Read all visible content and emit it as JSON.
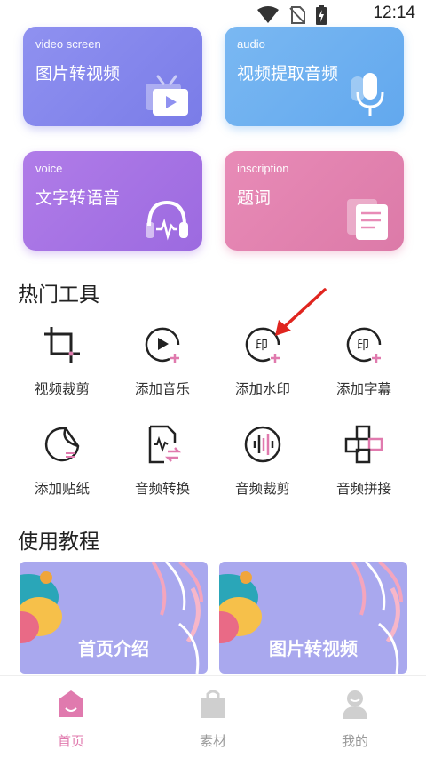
{
  "status_bar": {
    "time": "12:14"
  },
  "cards": [
    {
      "en": "video screen",
      "zh": "图片转视频",
      "icon": "tv-icon"
    },
    {
      "en": "audio",
      "zh": "视频提取音频",
      "icon": "microphone-icon"
    },
    {
      "en": "voice",
      "zh": "文字转语音",
      "icon": "headphones-icon"
    },
    {
      "en": "inscription",
      "zh": "题词",
      "icon": "document-icon"
    }
  ],
  "hot_tools": {
    "title": "热门工具",
    "items": [
      {
        "label": "视频裁剪",
        "icon": "crop-icon"
      },
      {
        "label": "添加音乐",
        "icon": "add-music-icon"
      },
      {
        "label": "添加水印",
        "icon": "add-watermark-icon",
        "glyph": "印"
      },
      {
        "label": "添加字幕",
        "icon": "add-subtitle-icon",
        "glyph": "印"
      },
      {
        "label": "添加贴纸",
        "icon": "sticker-icon"
      },
      {
        "label": "音频转换",
        "icon": "audio-convert-icon"
      },
      {
        "label": "音频裁剪",
        "icon": "audio-cut-icon"
      },
      {
        "label": "音频拼接",
        "icon": "audio-join-icon"
      }
    ]
  },
  "tutorials": {
    "title": "使用教程",
    "items": [
      {
        "label": "首页介绍"
      },
      {
        "label": "图片转视频"
      }
    ]
  },
  "bottom_nav": {
    "active_color": "#e07aae",
    "inactive_color": "#9a9a9a",
    "items": [
      {
        "label": "首页",
        "icon": "home-icon",
        "active": true
      },
      {
        "label": "素材",
        "icon": "bag-icon",
        "active": false
      },
      {
        "label": "我的",
        "icon": "profile-icon",
        "active": false
      }
    ]
  },
  "colors": {
    "card1": "#8f91f0",
    "card2": "#7ab8f2",
    "card3": "#b07ce8",
    "card4": "#e88bb7",
    "accent": "#e07aae",
    "annotation": "#e0251f"
  }
}
